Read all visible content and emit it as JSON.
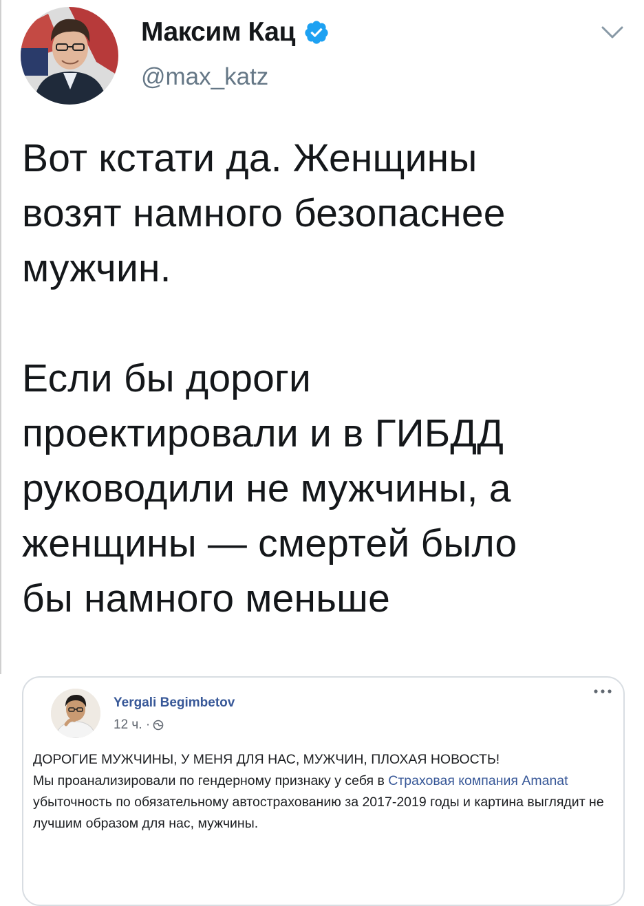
{
  "tweet": {
    "author": {
      "display_name": "Максим Кац",
      "handle": "@max_katz",
      "verified": true,
      "avatar_icon": "profile-photo"
    },
    "text_paragraph_1": "Вот кстати да. Женщины\nвозят намного безопаснее\nмужчин.",
    "text_paragraph_2": "Если бы дороги\nпроектировали и в ГИБДД\nруководили не мужчины, а\nженщины — смертей было\nбы намного меньше",
    "menu_icon": "chevron-down-icon"
  },
  "embedded_post": {
    "author": "Yergali Begimbetov",
    "time": "12 ч. · ",
    "privacy_icon": "globe-icon",
    "menu_icon": "more-icon",
    "headline": "ДОРОГИЕ МУЖЧИНЫ, У МЕНЯ ДЛЯ НАС, МУЖЧИН, ПЛОХАЯ НОВОСТЬ!",
    "body_before_link": "Мы проанализировали по гендерному признаку у себя в ",
    "link_text": "Страховая компания Amanat",
    "body_after_link": " убыточность по обязательному автострахованию за 2017-2019 годы и картина выглядит не лучшим образом для нас, мужчины."
  },
  "colors": {
    "twitter_text": "#14171a",
    "twitter_secondary": "#657786",
    "twitter_blue": "#1da1f2",
    "facebook_link": "#385898",
    "card_border": "#d8dde2"
  }
}
